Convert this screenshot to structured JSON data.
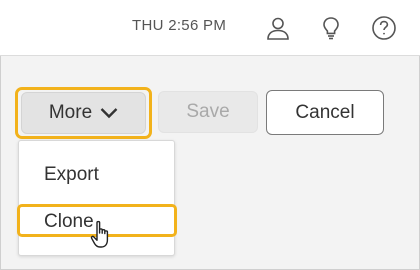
{
  "header": {
    "clock": "THU 2:56 PM",
    "icons": [
      "user-icon",
      "lightbulb-icon",
      "help-icon"
    ]
  },
  "toolbar": {
    "more_label": "More",
    "save_label": "Save",
    "cancel_label": "Cancel"
  },
  "menu": {
    "items": [
      {
        "label": "Export"
      },
      {
        "label": "Clone"
      }
    ]
  },
  "colors": {
    "highlight": "#f2b21b",
    "disabled_text": "#a9a9a9"
  }
}
